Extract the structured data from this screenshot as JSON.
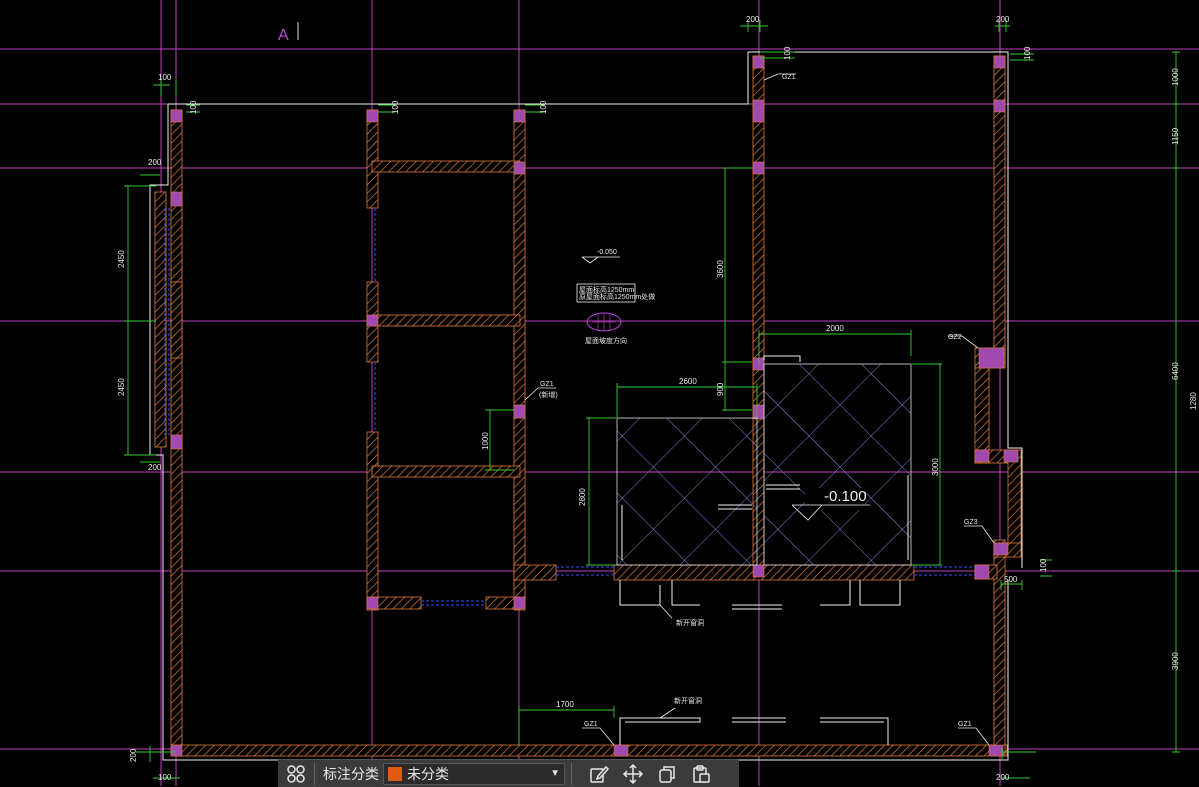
{
  "cad": {
    "grid_label": "A",
    "col_dims": {
      "left_top": "100",
      "left_bottom": "100",
      "right_upper_top": "200",
      "right_top": "200",
      "right_bottom": "200"
    },
    "wall_dims": {
      "top_a": "100",
      "top_b": "100",
      "top_c": "100",
      "top_d": "100",
      "top_e": "100",
      "top_f": "100"
    },
    "left_dims": {
      "upper": "2450",
      "lower": "2450",
      "a": "200",
      "b": "200",
      "c": "200"
    },
    "right_dims": {
      "d1": "1000",
      "d2": "1150",
      "d3": "6400",
      "d4": "1280",
      "d5": "3900"
    },
    "room_dims": {
      "h3600": "3600",
      "w2000": "2000",
      "w2600": "2600",
      "h900": "900",
      "h2800": "2800",
      "h3000": "3000",
      "h1000": "1000",
      "w1700": "1700",
      "w500": "500",
      "h200": "200"
    },
    "labels": {
      "level_upper": "-0.050",
      "level_main": "-0.100",
      "gz_a": "GZ1",
      "gz_b": "GZ2",
      "gz_c": "GZ1",
      "gz_c_sub": "(新增)",
      "gz_d": "GZ3",
      "gz_e": "GZ1",
      "gz_f": "GZ1",
      "note_box_line1": "屋面标高1250mm",
      "note_box_line2": "原屋面标高1250mm处做",
      "ellipse_caption": "屋面坡度方向",
      "leader_a": "新开窗洞",
      "leader_b": "新开窗洞"
    }
  },
  "toolbar": {
    "label": "标注分类",
    "select_value": "未分类",
    "select_color": "#e05a12"
  },
  "colors": {
    "wall": "#e07a3a",
    "column": "#b050b0",
    "grid": "#c040c0",
    "dim": "#33cc33",
    "line": "#f0f0f0"
  }
}
